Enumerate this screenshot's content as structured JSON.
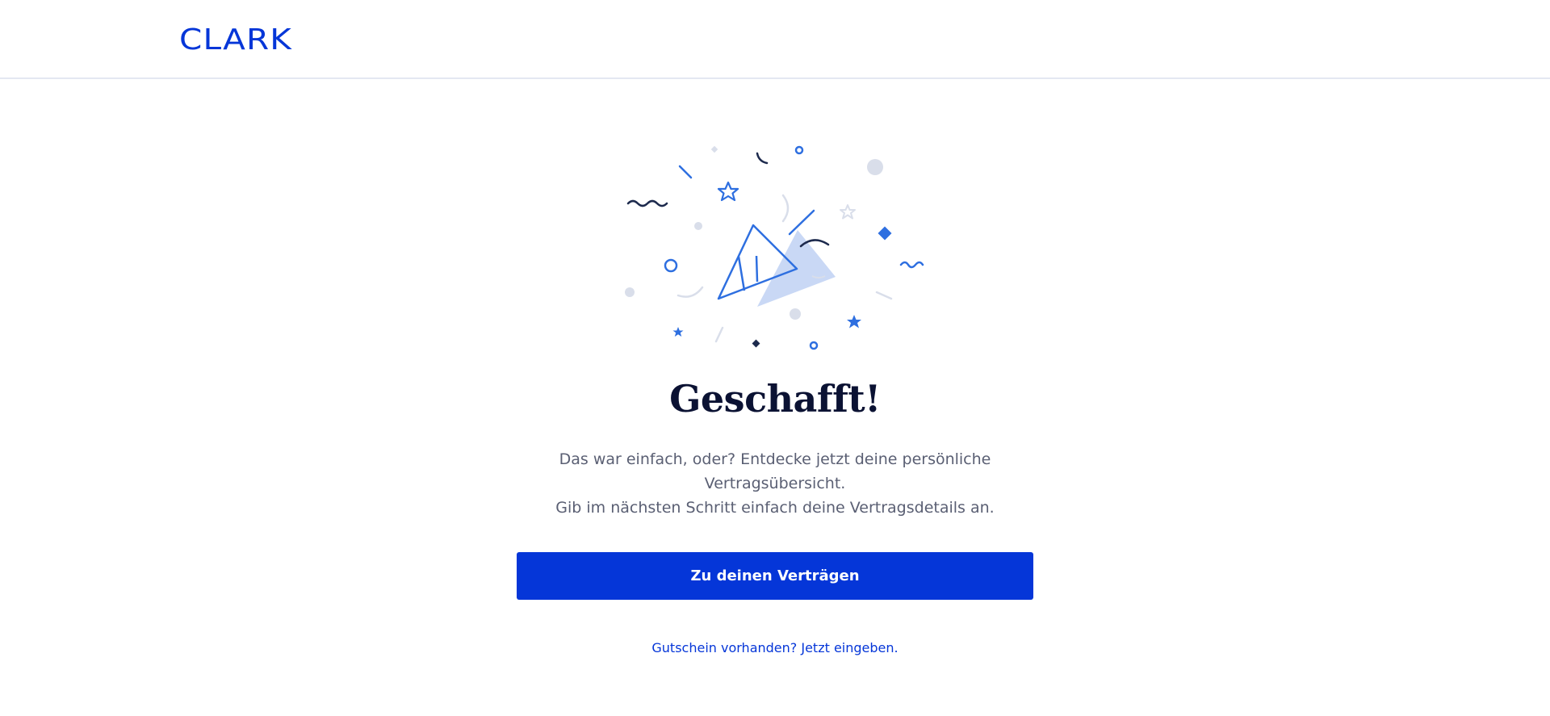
{
  "header": {
    "logo_text": "CLARK",
    "brand_color": "#0536d8"
  },
  "illustration": {
    "icon": "party-popper-confetti-icon"
  },
  "main": {
    "title": "Geschafft!",
    "description_lines": [
      "Das war einfach, oder? Entdecke jetzt deine persönliche",
      "Vertragsübersicht.",
      "Gib im nächsten Schritt einfach deine Vertragsdetails an."
    ],
    "cta_label": "Zu deinen Verträgen",
    "voucher_link": "Gutschein vorhanden? Jetzt eingeben."
  },
  "colors": {
    "primary": "#0536d8",
    "accent_blue": "#2e6fe0",
    "navy": "#1d2a4d",
    "light_grey": "#d9deea",
    "text_dark": "#0b1233",
    "text_muted": "#5a5f73"
  }
}
